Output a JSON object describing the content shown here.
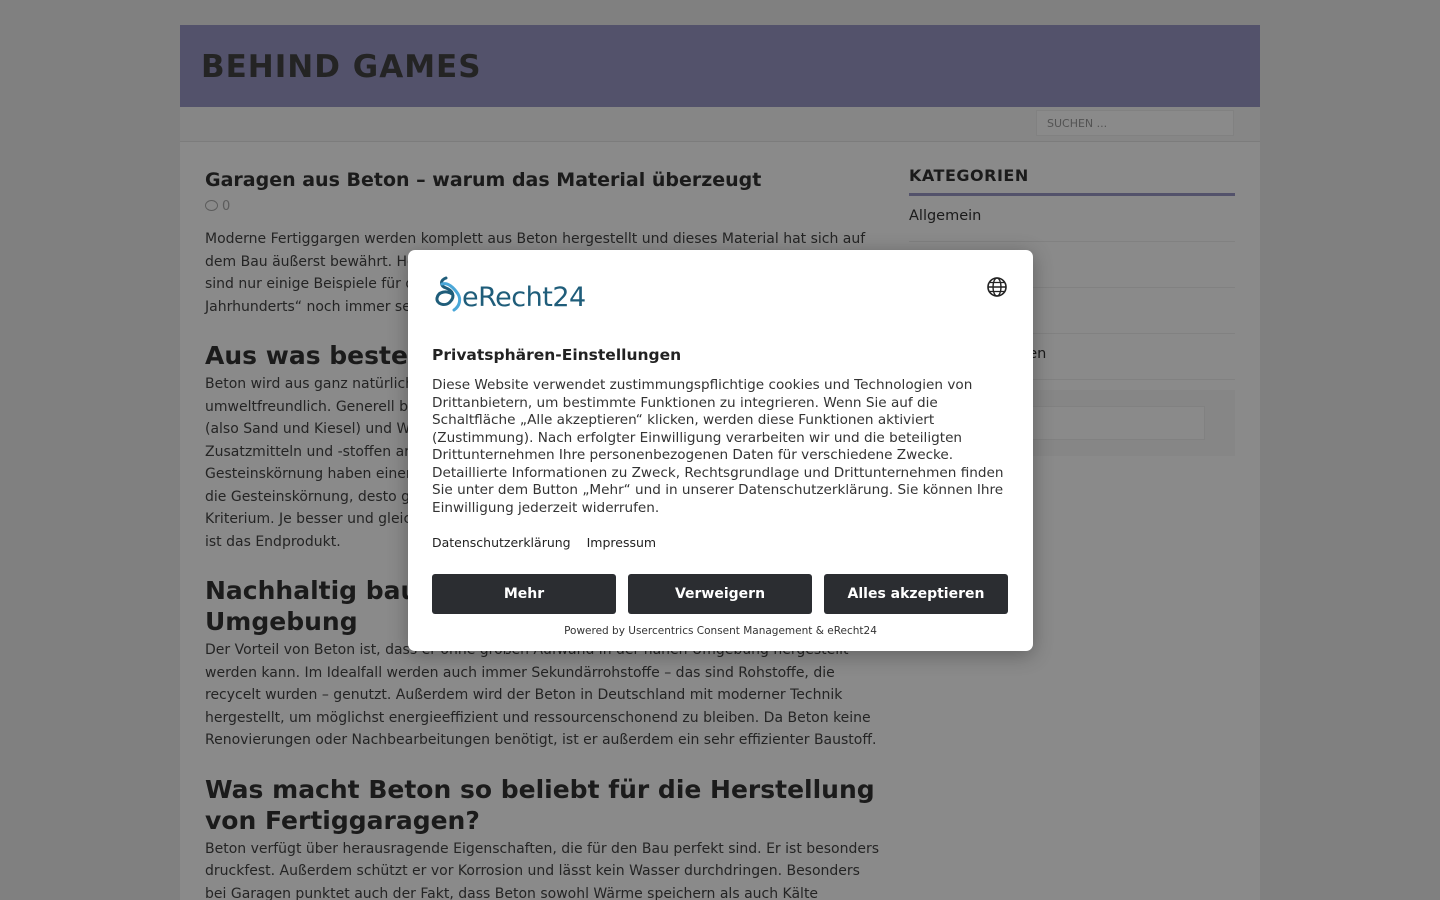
{
  "site": {
    "title": "BEHIND GAMES",
    "search_placeholder": "SUCHEN ...",
    "accent_color": "#9a98c6"
  },
  "article": {
    "title": "Garagen aus Beton – warum das Material überzeugt",
    "comment_count": "0",
    "intro": "Moderne Fertiggargen werden komplett aus Beton hergestellt und dieses Material hat sich auf dem Bau äußerst bewährt. Hohe Stabilität, lange Lebensdauer und eine ansprechende Optik sind nur einige Beispiele für die Vorzüge des Baustoffs. Kein Wunder, dass er als „Baustoff des Jahrhunderts“ noch immer sehr beliebt ist.",
    "h2_1": "Aus was besteht Beton?",
    "p1": "Beton wird aus ganz natürlichen Rohstoffen hergestellt und ist deshalb auch besonders umweltfreundlich. Generell besteht Beton aus Zement als Bindemittel, einer Gesteinskörnung (also Sand und Kiesel) und Wasser. Manchmal wird der Beton zusätzlich noch mit Luft, Zusatzmitteln und -stoffen angereichert, um bestimmte Eigenschaften zu erreichen. Auch die Gesteinskörnung haben einen erheblichen Einfluss auf die Qualität und Eigenschaften. Je feiner die Gesteinskörnung, desto glatter die Oberfläche. Auch die Verarbeitbarkeit ist ein wichtiges Kriterium. Je besser und gleichmäßiger der Beton verarbeitet werden kann, desto hochwertiger ist das Endprodukt.",
    "h2_2": "Nachhaltig bauen mit Beton aus der direkten Umgebung",
    "p2": "Der Vorteil von Beton ist, dass er ohne großen Aufwand in der nahen Umgebung hergestellt werden kann. Im Idealfall werden auch immer Sekundärrohstoffe – das sind Rohstoffe, die recycelt wurden – genutzt. Außerdem wird der Beton in Deutschland mit moderner Technik hergestellt, um möglichst energieeffizient und ressourcenschonend zu bleiben. Da Beton keine Renovierungen oder Nachbearbeitungen benötigt, ist er außerdem ein sehr effizienter Baustoff.",
    "h2_3": "Was macht Beton so beliebt für die Herstellung von Fertiggaragen?",
    "p3": "Beton verfügt über herausragende Eigenschaften, die für den Bau perfekt sind. Er ist besonders druckfest. Außerdem schützt er vor Korrosion und lässt kein Wasser durchdringen. Besonders bei Garagen punktet auch der Fakt, dass Beton sowohl Wärme speichern als auch Kälte"
  },
  "sidebar": {
    "widget_title": "KATEGORIEN",
    "categories": [
      "Allgemein",
      "",
      "",
      "gen"
    ]
  },
  "consent": {
    "brand": "eRecht24",
    "title": "Privatsphären-Einstellungen",
    "text": "Diese Website verwendet zustimmungspflichtige cookies und Technologien von Drittanbietern, um bestimmte Funktionen zu integrieren. Wenn Sie auf die Schaltfläche „Alle akzeptieren“ klicken, werden diese Funktionen aktiviert (Zustimmung). Nach erfolgter Einwilligung verarbeiten wir und die beteiligten Drittunternehmen Ihre personenbezogenen Daten für verschiedene Zwecke. Detaillierte Informationen zu Zweck, Rechtsgrundlage und Drittunternehmen finden Sie unter dem Button „Mehr“ und in unserer Datenschutzerklärung. Sie können Ihre Einwilligung jederzeit widerrufen.",
    "link_privacy": "Datenschutzerklärung",
    "link_imprint": "Impressum",
    "btn_more": "Mehr",
    "btn_deny": "Verweigern",
    "btn_accept": "Alles akzeptieren",
    "powered": "Powered by Usercentrics Consent Management & eRecht24"
  }
}
